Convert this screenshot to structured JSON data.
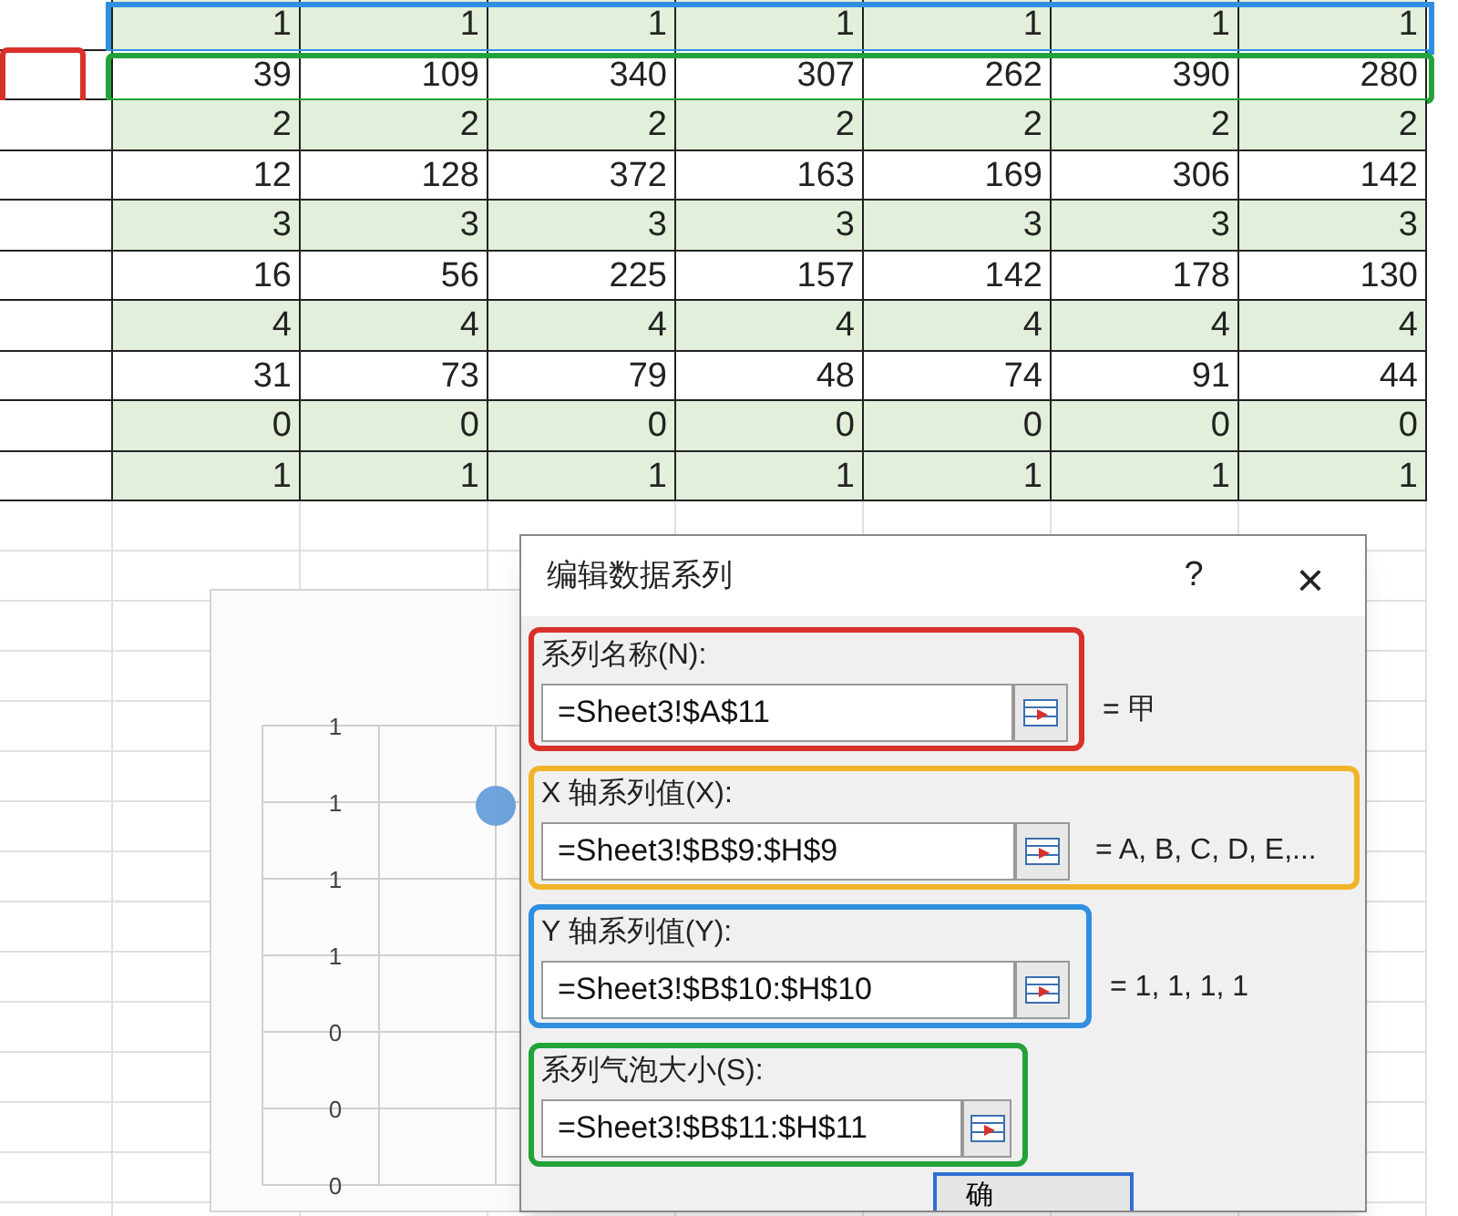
{
  "sheet": {
    "rows": [
      {
        "cells": [
          "1",
          "1",
          "1",
          "1",
          "1",
          "1",
          "1"
        ],
        "shaded": true,
        "color": "#2f8fe0"
      },
      {
        "cells": [
          "39",
          "109",
          "340",
          "307",
          "262",
          "390",
          "280"
        ],
        "shaded": false,
        "color": "#22a33a",
        "label_highlight": {
          "color": "#d9302a"
        }
      },
      {
        "cells": [
          "2",
          "2",
          "2",
          "2",
          "2",
          "2",
          "2"
        ],
        "shaded": true
      },
      {
        "cells": [
          "12",
          "128",
          "372",
          "163",
          "169",
          "306",
          "142"
        ],
        "shaded": false
      },
      {
        "cells": [
          "3",
          "3",
          "3",
          "3",
          "3",
          "3",
          "3"
        ],
        "shaded": true
      },
      {
        "cells": [
          "16",
          "56",
          "225",
          "157",
          "142",
          "178",
          "130"
        ],
        "shaded": false
      },
      {
        "cells": [
          "4",
          "4",
          "4",
          "4",
          "4",
          "4",
          "4"
        ],
        "shaded": true
      },
      {
        "cells": [
          "31",
          "73",
          "79",
          "48",
          "74",
          "91",
          "44"
        ],
        "shaded": false
      },
      {
        "cells": [
          "0",
          "0",
          "0",
          "0",
          "0",
          "0",
          "0"
        ],
        "shaded": true
      },
      {
        "cells": [
          "1",
          "1",
          "1",
          "1",
          "1",
          "1",
          "1"
        ],
        "shaded": true
      }
    ]
  },
  "chart": {
    "y_tick_labels": [
      "1",
      "1",
      "1",
      "1",
      "0",
      "0",
      "0"
    ]
  },
  "dialog": {
    "title": "编辑数据系列",
    "help": "?",
    "close": "×",
    "fields": [
      {
        "label": "系列名称(N):",
        "value": "=Sheet3!$A$11",
        "preview": "= 甲",
        "color": "#d9302a"
      },
      {
        "label": "X 轴系列值(X):",
        "value": "=Sheet3!$B$9:$H$9",
        "preview": "= A, B, C, D, E,...",
        "color": "#f0b429"
      },
      {
        "label": "Y 轴系列值(Y):",
        "value": "=Sheet3!$B$10:$H$10",
        "preview": "= 1, 1, 1, 1",
        "color": "#2f8fe0"
      },
      {
        "label": "系列气泡大小(S):",
        "value": "=Sheet3!$B$11:$H$11",
        "color": "#22a33a"
      }
    ],
    "ok_button": "确"
  }
}
